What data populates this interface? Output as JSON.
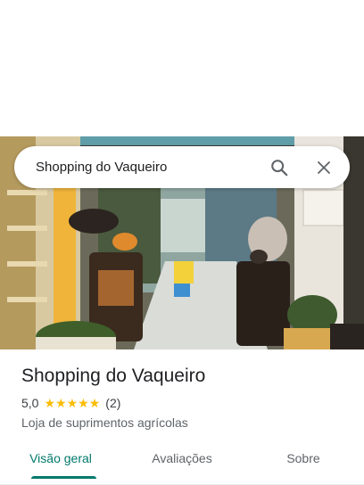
{
  "search": {
    "query": "Shopping do Vaqueiro",
    "search_icon": "search-icon",
    "close_icon": "close-icon"
  },
  "photo": {
    "subject": "store-front-photo"
  },
  "place": {
    "title": "Shopping do Vaqueiro",
    "rating": "5,0",
    "stars": 5,
    "review_count": "(2)",
    "category": "Loja de suprimentos agrícolas"
  },
  "tabs": [
    {
      "label": "Visão geral",
      "active": true
    },
    {
      "label": "Avaliações",
      "active": false
    },
    {
      "label": "Sobre",
      "active": false
    }
  ],
  "colors": {
    "accent": "#00796b",
    "star": "#fbbc04",
    "title": "#202124",
    "secondary": "#5f6368"
  }
}
